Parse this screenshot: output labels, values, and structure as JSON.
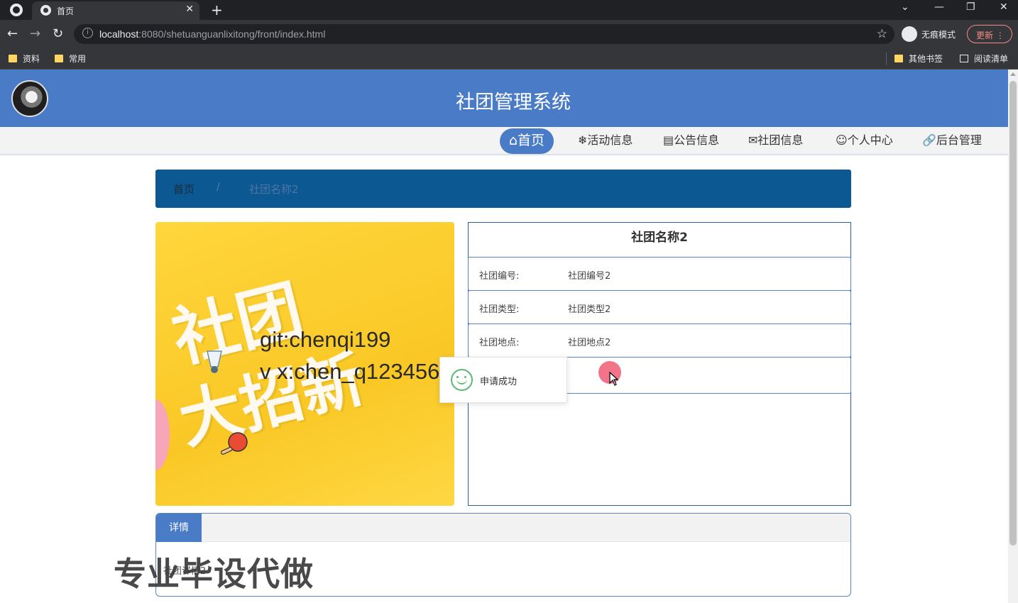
{
  "browser": {
    "tab_title": "首页",
    "tab_close": "✕",
    "new_tab": "+",
    "url_host": "localhost",
    "url_path": ":8080/shetuanguanlixitong/front/index.html",
    "incognito_label": "无痕模式",
    "update_label": "更新",
    "bookmarks": [
      "资料",
      "常用"
    ],
    "other_bookmarks": "其他书签",
    "reading_list": "阅读清单"
  },
  "site": {
    "title": "社团管理系统"
  },
  "nav": {
    "items": [
      {
        "icon": "⌂",
        "label": "首页"
      },
      {
        "icon": "❄",
        "label": "活动信息"
      },
      {
        "icon": "▤",
        "label": "公告信息"
      },
      {
        "icon": "✉",
        "label": "社团信息"
      },
      {
        "icon": "☺",
        "label": "个人中心"
      },
      {
        "icon": "🔗",
        "label": "后台管理"
      }
    ]
  },
  "breadcrumb": {
    "home": "首页",
    "separator": "/",
    "current": "社团名称2"
  },
  "poster": {
    "line1": "社团",
    "line2": "大招新",
    "watermark_line1": "git:chenqi199",
    "watermark_line2": "v x:chen_q123456"
  },
  "club": {
    "name": "社团名称2",
    "fields": [
      {
        "label": "社团编号:",
        "value": "社团编号2"
      },
      {
        "label": "社团类型:",
        "value": "社团类型2"
      },
      {
        "label": "社团地点:",
        "value": "社团地点2"
      }
    ]
  },
  "toast": {
    "message": "申请成功"
  },
  "details": {
    "tab_label": "详情",
    "body": "社团详情2"
  },
  "overlay_text": "专业毕设代做",
  "colors": {
    "brand": "#4a7bc7",
    "breadcrumb_bg": "#0b5893",
    "poster_bg": "#f9c825",
    "success": "#5fb878"
  }
}
